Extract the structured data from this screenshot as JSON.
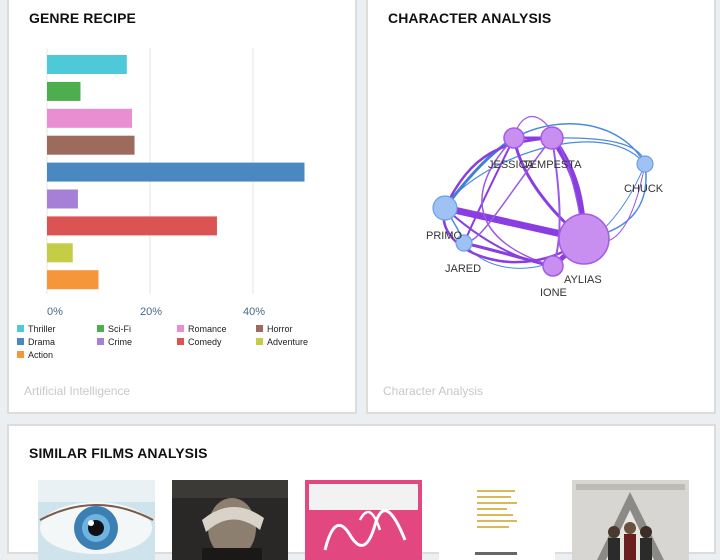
{
  "genre_card": {
    "title": "GENRE RECIPE",
    "footer": "Artificial Intelligence"
  },
  "character_card": {
    "title": "CHARACTER ANALYSIS",
    "footer": "Character Analysis"
  },
  "similar_card": {
    "title": "SIMILAR FILMS ANALYSIS"
  },
  "chart_data": {
    "type": "bar",
    "orientation": "horizontal",
    "categories": [
      "Thriller",
      "Sci-Fi",
      "Romance",
      "Horror",
      "Drama",
      "Crime",
      "Comedy",
      "Adventure",
      "Action"
    ],
    "values": [
      15.5,
      6.5,
      16.5,
      17.0,
      50.0,
      6.0,
      33.0,
      5.0,
      10.0
    ],
    "colors": [
      "#4dc9d7",
      "#4cae4c",
      "#e98ed0",
      "#9c6b5e",
      "#4a88c2",
      "#a67fd6",
      "#dc5353",
      "#c5cc45",
      "#f5963a"
    ],
    "xlim": [
      0,
      52
    ],
    "x_ticks": [
      "0%",
      "20%",
      "40%"
    ],
    "x_tick_values": [
      0,
      20,
      40
    ],
    "grid": true,
    "legend_placement": "bottom"
  },
  "network": {
    "nodes": [
      {
        "id": "jessica",
        "label": "JESSICA",
        "size": "small"
      },
      {
        "id": "tempesta",
        "label": "TEMPESTA",
        "size": "small"
      },
      {
        "id": "chuck",
        "label": "CHUCK",
        "size": "small"
      },
      {
        "id": "primo",
        "label": "PRIMO",
        "size": "medium"
      },
      {
        "id": "jared",
        "label": "JARED",
        "size": "small"
      },
      {
        "id": "aylias",
        "label": "AYLIAS",
        "size": "large"
      },
      {
        "id": "ione",
        "label": "IONE",
        "size": "small"
      }
    ]
  },
  "films": [
    {
      "name": "film-poster-1"
    },
    {
      "name": "film-poster-2"
    },
    {
      "name": "film-poster-3"
    },
    {
      "name": "film-poster-4"
    },
    {
      "name": "film-poster-5"
    }
  ]
}
